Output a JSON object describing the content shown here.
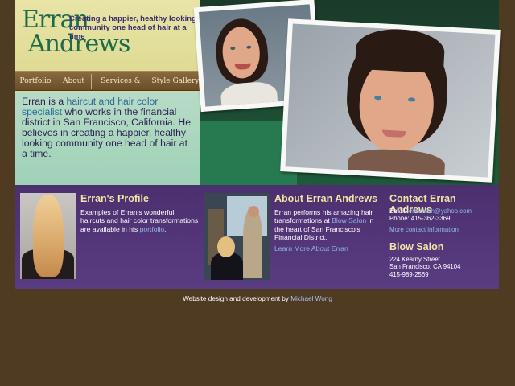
{
  "header": {
    "logo_line1": "Erran",
    "logo_line2": "Andrews",
    "tagline": "Creating a happier, healthy looking community one head of hair at a time"
  },
  "nav": {
    "items": [
      {
        "label": "Portfolio"
      },
      {
        "label": "About"
      },
      {
        "label": "Services & Fees"
      },
      {
        "label": "Style Gallery"
      }
    ]
  },
  "intro": {
    "text_before": "Erran is a ",
    "link_text": "haircut and hair color specialist",
    "text_after": " who works in the financial district in San Francisco, California. He believes in creating a happier, healthy looking community one head of hair at a time."
  },
  "profile": {
    "title": "Erran's Profile",
    "text_before": "Examples of Erran's wonderful haircuts and hair color transformations are available in his ",
    "link_text": "portfolio",
    "text_after": "."
  },
  "about": {
    "title": "About Erran Andrews",
    "text_before": "Erran performs his amazing hair transformations at ",
    "link_text": "Blow Salon",
    "text_after": " in the heart of San Francisco's Financial District.",
    "more_link": "Learn More About Erran"
  },
  "contact": {
    "title": "Contact Erran Andrews",
    "email_label": "Email: ",
    "email": "erranwsh@yahoo.com",
    "phone": "Phone: 415-362-3369",
    "more_link": "More contact information"
  },
  "salon": {
    "title": "Blow Salon",
    "address1": "224 Kearny Street",
    "address2": "San Francisco, CA 94104",
    "phone": "415-989-2569"
  },
  "footer": {
    "text": "Website design and development by ",
    "link_text": "Michael Wong"
  },
  "colors": {
    "background": "#4f3a22",
    "header": "#ddd98f",
    "nav": "#7a5c34",
    "intro": "#a8d6bc",
    "content": "#523579",
    "heading": "#f3e4a6",
    "link": "#8eb6ea"
  }
}
